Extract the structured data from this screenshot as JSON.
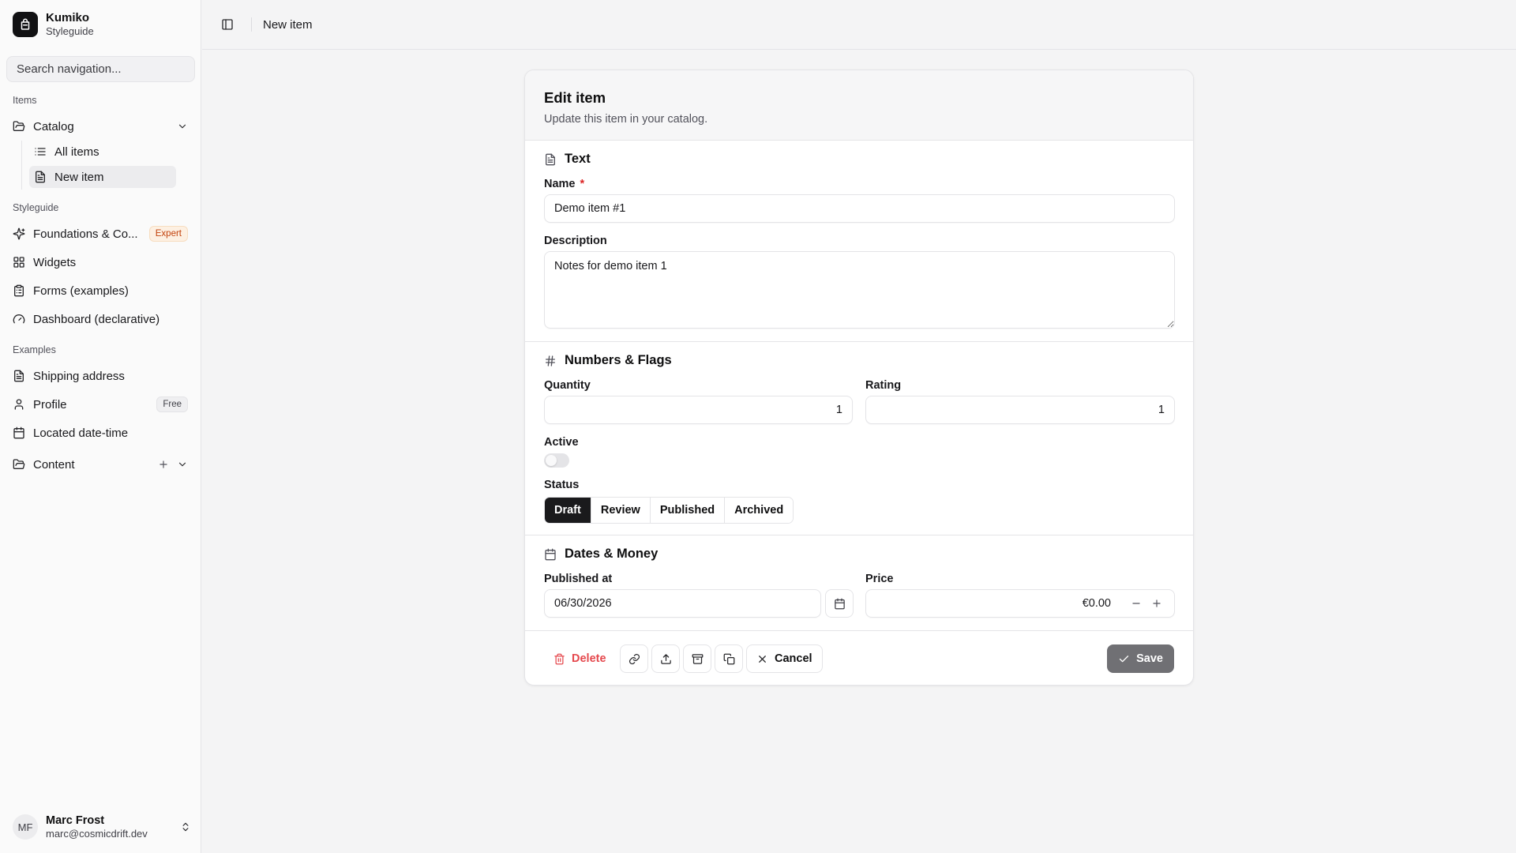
{
  "app": {
    "name": "Kumiko",
    "subtitle": "Styleguide"
  },
  "search": {
    "placeholder": "Search navigation..."
  },
  "nav": {
    "items_group": "Items",
    "catalog": "Catalog",
    "all_items": "All items",
    "new_item": "New item",
    "styleguide_group": "Styleguide",
    "foundations": "Foundations & Co...",
    "foundations_badge": "Expert",
    "widgets": "Widgets",
    "forms": "Forms (examples)",
    "dashboard": "Dashboard (declarative)",
    "examples_group": "Examples",
    "shipping": "Shipping address",
    "profile": "Profile",
    "profile_badge": "Free",
    "located": "Located date-time",
    "content": "Content"
  },
  "user": {
    "initials": "MF",
    "name": "Marc Frost",
    "email": "marc@cosmicdrift.dev"
  },
  "topbar": {
    "breadcrumb": "New item"
  },
  "card": {
    "title": "Edit item",
    "description": "Update this item in your catalog.",
    "sections": {
      "text": "Text",
      "numbers": "Numbers & Flags",
      "dates": "Dates & Money"
    },
    "fields": {
      "name_label": "Name",
      "name_required": "*",
      "name_value": "Demo item #1",
      "description_label": "Description",
      "description_value": "Notes for demo item 1",
      "quantity_label": "Quantity",
      "quantity_value": "1",
      "rating_label": "Rating",
      "rating_value": "1",
      "active_label": "Active",
      "active_value": false,
      "status_label": "Status",
      "status_options": [
        "Draft",
        "Review",
        "Published",
        "Archived"
      ],
      "status_selected": "Draft",
      "published_label": "Published at",
      "published_value": "06/30/2026",
      "price_label": "Price",
      "price_value": "€0.00"
    },
    "footer": {
      "delete": "Delete",
      "cancel": "Cancel",
      "save": "Save"
    }
  },
  "colors": {
    "accent": "#1a1a1c",
    "danger": "#e5484d",
    "save_disabled": "#707074",
    "badge_expert": "#c2410c"
  }
}
